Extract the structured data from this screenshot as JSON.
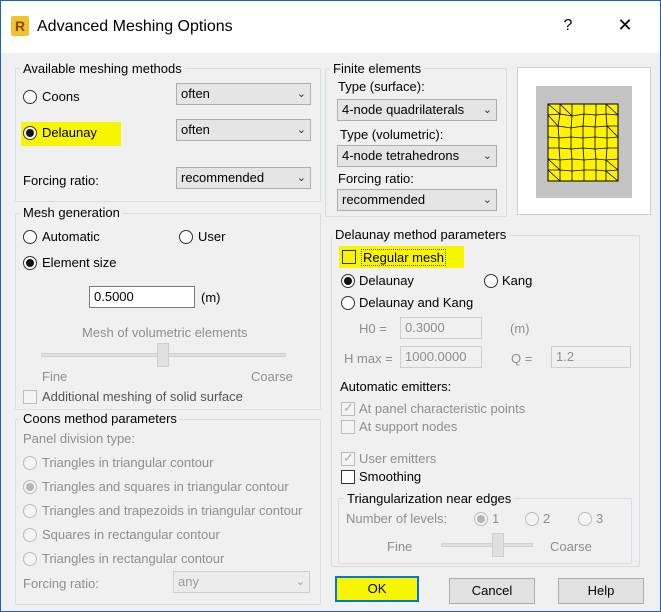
{
  "window": {
    "title": "Advanced Meshing Options",
    "app_icon_letter": "R",
    "help_glyph": "?",
    "close_glyph": "✕"
  },
  "available_methods": {
    "label": "Available meshing methods",
    "coons": "Coons",
    "coons_value": "often",
    "delaunay": "Delaunay",
    "delaunay_value": "often",
    "forcing_label": "Forcing ratio:",
    "forcing_value": "recommended"
  },
  "finite_elements": {
    "label": "Finite elements",
    "type_surface_label": "Type (surface):",
    "type_surface_value": "4-node quadrilaterals",
    "type_volumetric_label": "Type (volumetric):",
    "type_volumetric_value": "4-node tetrahedrons",
    "forcing_label": "Forcing ratio:",
    "forcing_value": "recommended"
  },
  "mesh_generation": {
    "label": "Mesh generation",
    "automatic": "Automatic",
    "user": "User",
    "element_size": "Element size",
    "size_value": "0.5000",
    "size_unit": "(m)",
    "volumetric_label": "Mesh of volumetric elements",
    "fine": "Fine",
    "coarse": "Coarse",
    "additional": "Additional meshing of solid surface"
  },
  "delaunay_params": {
    "label": "Delaunay method parameters",
    "regular_mesh": "Regular mesh",
    "delaunay": "Delaunay",
    "kang": "Kang",
    "delaunay_and_kang": "Delaunay and Kang",
    "h0_label": "H0 =",
    "h0_value": "0.3000",
    "h0_unit": "(m)",
    "hmax_label": "H max =",
    "hmax_value": "1000.0000",
    "q_label": "Q =",
    "q_value": "1.2",
    "auto_emitters_label": "Automatic emitters:",
    "at_panel": "At panel characteristic points",
    "at_support": "At support nodes",
    "user_emitters": "User emitters",
    "smoothing": "Smoothing"
  },
  "triangularization": {
    "label": "Triangularization near edges",
    "levels_label": "Number of levels:",
    "level1": "1",
    "level2": "2",
    "level3": "3",
    "fine": "Fine",
    "coarse": "Coarse"
  },
  "coons_params": {
    "label": "Coons method parameters",
    "panel_division_label": "Panel division type:",
    "opt1": "Triangles in triangular contour",
    "opt2": "Triangles and squares in triangular contour",
    "opt3": "Triangles and trapezoids in triangular contour",
    "opt4": "Squares in rectangular contour",
    "opt5": "Triangles in rectangular contour",
    "forcing_label": "Forcing ratio:",
    "forcing_value": "any"
  },
  "buttons": {
    "ok": "OK",
    "cancel": "Cancel",
    "help": "Help"
  },
  "colors": {
    "highlight": "#f8f500",
    "accent": "#1e5fbf"
  },
  "icons": [
    "app-icon",
    "help-icon",
    "close-icon",
    "chevron-down-icon",
    "mesh-preview"
  ]
}
